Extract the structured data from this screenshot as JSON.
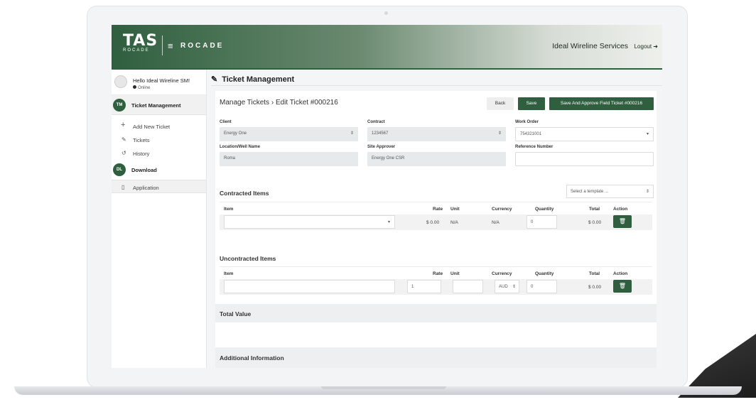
{
  "header": {
    "logo_main": "TAS",
    "logo_sub": "ROCADE",
    "product": "ROCADE",
    "company": "Ideal Wireline Services",
    "logout": "Logout"
  },
  "sidebar": {
    "greeting": "Hello Ideal Wireline SM!",
    "status": "Online",
    "sections": [
      {
        "badge": "TM",
        "label": "Ticket Management",
        "items": [
          {
            "icon": "plus-icon",
            "label": "Add New Ticket"
          },
          {
            "icon": "ticket-icon",
            "label": "Tickets"
          },
          {
            "icon": "history-icon",
            "label": "History"
          }
        ]
      },
      {
        "badge": "DL",
        "label": "Download",
        "items": [
          {
            "icon": "mobile-icon",
            "label": "Application"
          }
        ]
      }
    ]
  },
  "page": {
    "title": "Ticket Management",
    "breadcrumb_parent": "Manage Tickets",
    "breadcrumb_sep": "›",
    "breadcrumb_current": "Edit Ticket #000216",
    "back_label": "Back",
    "save_label": "Save",
    "approve_label": "Save And Approve Field Ticket #000216"
  },
  "form": {
    "client": {
      "label": "Client",
      "value": "Energy One"
    },
    "contract": {
      "label": "Contract",
      "value": "1234567"
    },
    "work_order": {
      "label": "Work Order",
      "value": "754321001"
    },
    "location": {
      "label": "Location/Well Name",
      "value": "Roma"
    },
    "site_approver": {
      "label": "Site Approver",
      "value": "Energy One CSR"
    },
    "reference": {
      "label": "Reference Number",
      "value": ""
    }
  },
  "contracted": {
    "title": "Contracted Items",
    "template_placeholder": "Select a template ...",
    "columns": [
      "Item",
      "Rate",
      "Unit",
      "Currency",
      "Quantity",
      "Total",
      "Action"
    ],
    "row": {
      "item": "",
      "rate": "$ 0.00",
      "unit": "N/A",
      "currency": "N/A",
      "quantity": "0",
      "total": "$ 0.00"
    }
  },
  "uncontracted": {
    "title": "Uncontracted Items",
    "columns": [
      "Item",
      "Rate",
      "Unit",
      "Currency",
      "Quantity",
      "Total",
      "Action"
    ],
    "row": {
      "item": "",
      "rate": "1",
      "unit": "",
      "currency": "AUD",
      "quantity": "0",
      "total": "$ 0.00"
    }
  },
  "total_value": {
    "title": "Total Value"
  },
  "additional": {
    "title": "Additional Information"
  },
  "colors": {
    "brand_green": "#2f5f3f",
    "panel_grey": "#eeeff0"
  }
}
